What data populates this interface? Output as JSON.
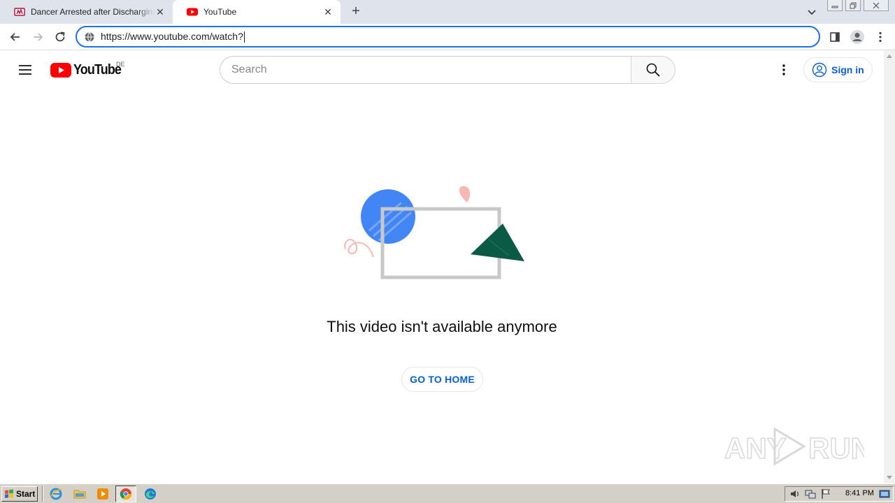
{
  "browser": {
    "tabs": [
      {
        "title": "Dancer Arrested after Discharging Gun",
        "active": false,
        "close": "✕"
      },
      {
        "title": "YouTube",
        "active": true,
        "close": "✕"
      }
    ],
    "new_tab": "+",
    "address": {
      "url": "https://www.youtube.com/watch?"
    },
    "icons": [
      "back-icon",
      "forward-icon",
      "reload-icon",
      "site-info-icon",
      "side-panel-icon",
      "profile-icon",
      "menu-kebab-icon"
    ]
  },
  "youtube": {
    "logo_text": "YouTube",
    "country_code": "DE",
    "search": {
      "placeholder": "Search",
      "value": ""
    },
    "sign_in_label": "Sign in",
    "brand_color": "#ff0000",
    "link_color": "#065fd4"
  },
  "main": {
    "message": "This video isn't available anymore",
    "home_button_label": "GO TO HOME"
  },
  "watermark": {
    "text_left": "ANY",
    "text_right": "RUN"
  },
  "taskbar": {
    "start_label": "Start",
    "clock": "8:41 PM",
    "pinned": [
      "internet-explorer-icon",
      "folder-icon",
      "media-player-icon",
      "chrome-icon",
      "edge-icon"
    ],
    "tray": [
      "volume-icon",
      "network-icon",
      "flag-icon",
      "show-desktop-icon"
    ]
  }
}
